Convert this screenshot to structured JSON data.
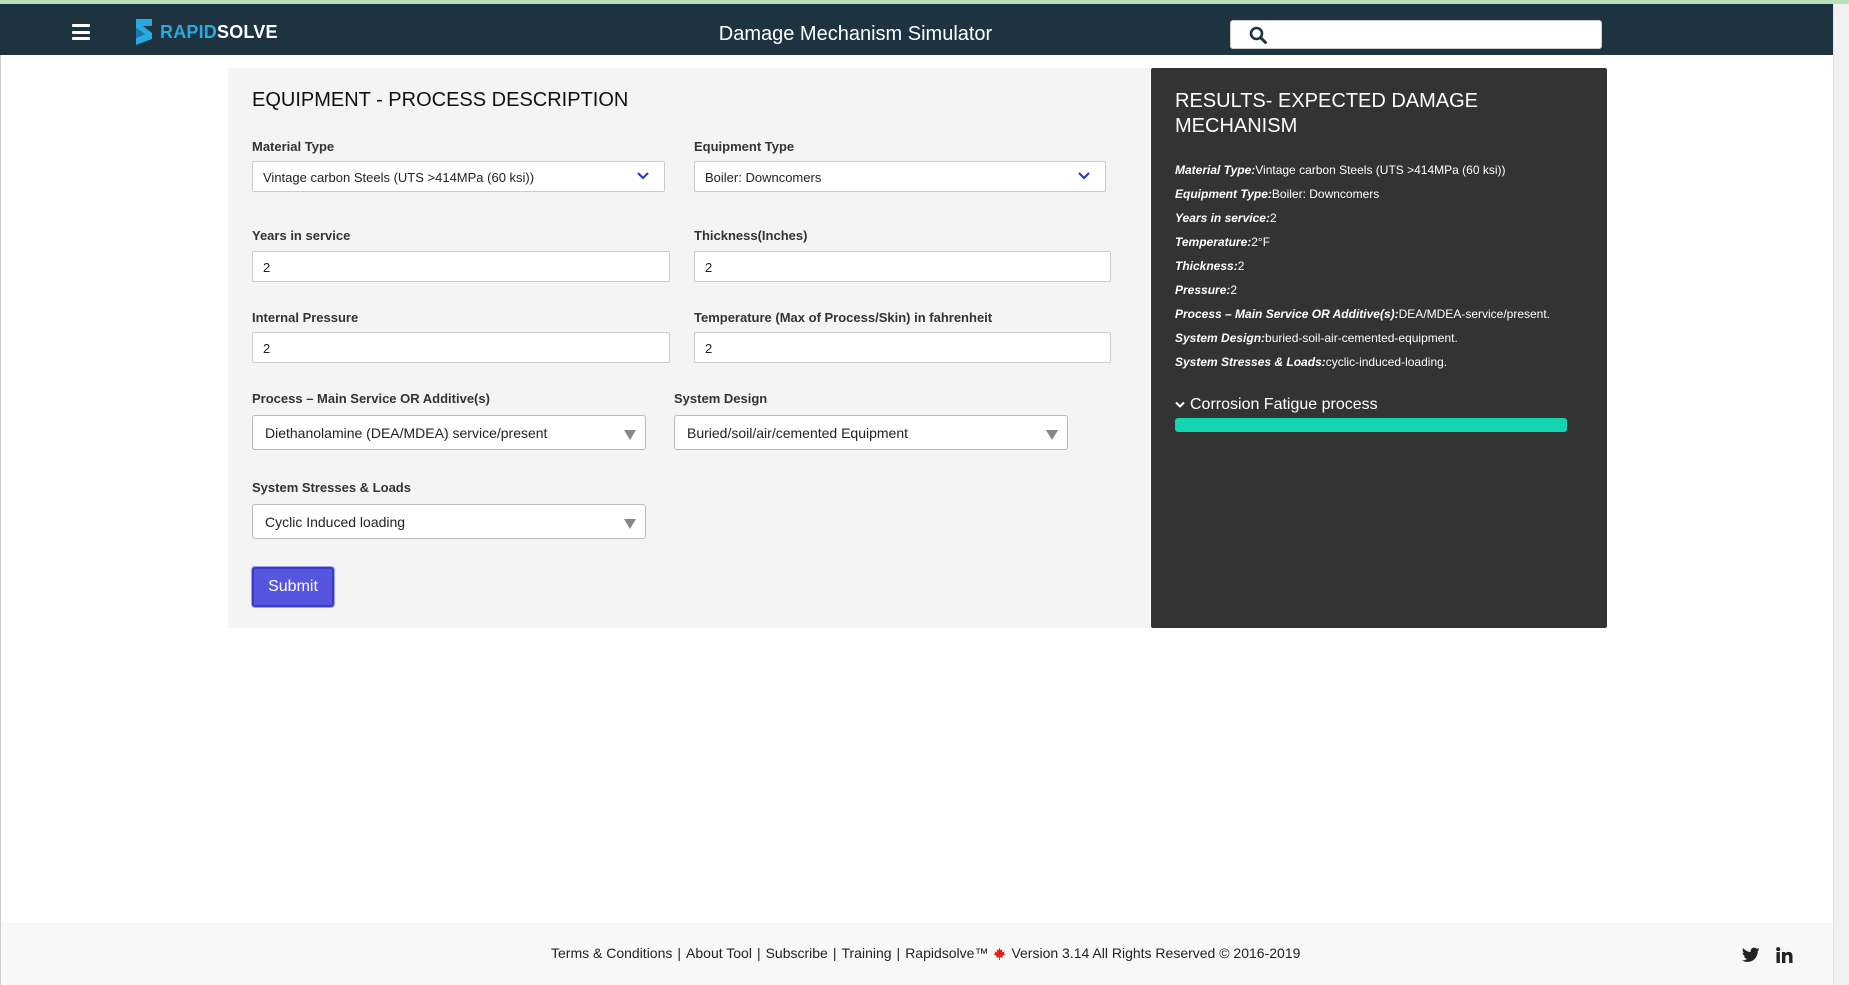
{
  "app": {
    "title": "Damage Mechanism Simulator",
    "logo_part1": "RAPID",
    "logo_part2": "SOLVE"
  },
  "search": {
    "placeholder": "",
    "value": ""
  },
  "form": {
    "title": "EQUIPMENT - PROCESS DESCRIPTION",
    "material_type": {
      "label": "Material Type",
      "value": "Vintage carbon Steels (UTS >414MPa (60 ksi))"
    },
    "equipment_type": {
      "label": "Equipment Type",
      "value": "Boiler: Downcomers"
    },
    "years_in_service": {
      "label": "Years in service",
      "value": "2"
    },
    "thickness": {
      "label": "Thickness(Inches)",
      "value": "2"
    },
    "internal_pressure": {
      "label": "Internal Pressure",
      "value": "2"
    },
    "temperature": {
      "label": "Temperature (Max of Process/Skin) in fahrenheit",
      "value": "2"
    },
    "process": {
      "label": "Process – Main Service OR Additive(s)",
      "value": "Diethanolamine (DEA/MDEA) service/present"
    },
    "system_design": {
      "label": "System Design",
      "value": "Buried/soil/air/cemented Equipment"
    },
    "system_stresses": {
      "label": "System Stresses & Loads",
      "value": "Cyclic Induced loading"
    },
    "submit_label": "Submit"
  },
  "results": {
    "title": "RESULTS- EXPECTED DAMAGE MECHANISM",
    "rows": [
      {
        "key": "Material Type:",
        "value": "Vintage carbon Steels (UTS >414MPa (60 ksi))"
      },
      {
        "key": "Equipment Type:",
        "value": "Boiler: Downcomers"
      },
      {
        "key": "Years in service:",
        "value": "2"
      },
      {
        "key": "Temperature:",
        "value": "2°F"
      },
      {
        "key": "Thickness:",
        "value": "2"
      },
      {
        "key": "Pressure:",
        "value": "2"
      },
      {
        "key": "Process – Main Service OR Additive(s):",
        "value": "DEA/MDEA-service/present."
      },
      {
        "key": "System Design:",
        "value": "buried-soil-air-cemented-equipment."
      },
      {
        "key": "System Stresses & Loads:",
        "value": "cyclic-induced-loading."
      }
    ],
    "mechanism": {
      "name": "Corrosion Fatigue process",
      "level": 1.0,
      "bar_color": "#13d4b0"
    }
  },
  "footer": {
    "terms": "Terms & Conditions",
    "about": "About Tool",
    "subscribe": "Subscribe",
    "training": "Training",
    "brand": "Rapidsolve™",
    "version": "Version 3.14 All Rights Reserved © 2016-2019"
  },
  "colors": {
    "navbar": "#1e3340",
    "accent": "#29a9e1",
    "submit": "#5555e0",
    "results_bg": "#333333"
  },
  "icons": [
    "hamburger-icon",
    "rapidsolve-logo-icon",
    "search-icon",
    "chevron-down-icon",
    "maple-leaf-icon",
    "twitter-icon",
    "linkedin-icon"
  ]
}
